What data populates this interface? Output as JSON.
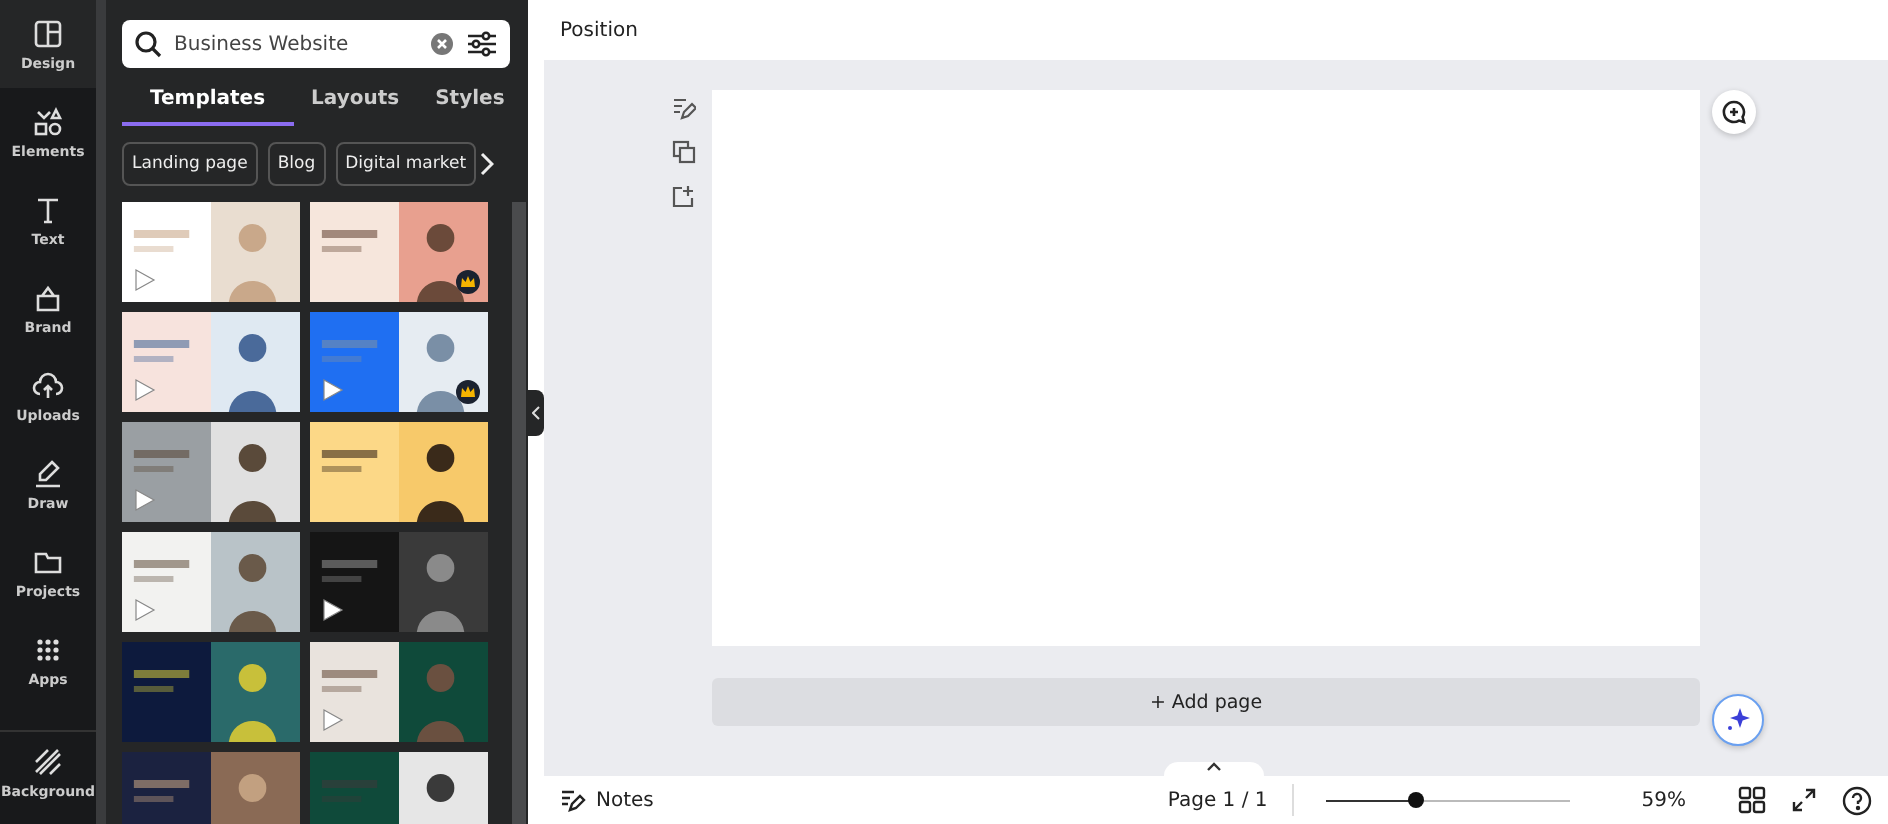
{
  "rail": [
    {
      "label": "Design",
      "selected": true
    },
    {
      "label": "Elements",
      "selected": false
    },
    {
      "label": "Text",
      "selected": false
    },
    {
      "label": "Brand",
      "selected": false
    },
    {
      "label": "Uploads",
      "selected": false
    },
    {
      "label": "Draw",
      "selected": false
    },
    {
      "label": "Projects",
      "selected": false
    },
    {
      "label": "Apps",
      "selected": false
    },
    {
      "label": "Background",
      "selected": false
    }
  ],
  "search": {
    "value": "Business Website"
  },
  "tabs": [
    {
      "label": "Templates",
      "selected": true
    },
    {
      "label": "Layouts",
      "selected": false
    },
    {
      "label": "Styles",
      "selected": false
    }
  ],
  "chips": [
    "Landing page",
    "Blog",
    "Digital market"
  ],
  "templates": [
    {
      "kind": "picture",
      "video": true,
      "premium": false
    },
    {
      "kind": "picture",
      "video": false,
      "premium": true
    },
    {
      "kind": "picture",
      "video": true,
      "premium": false
    },
    {
      "kind": "picture",
      "video": true,
      "premium": true
    },
    {
      "kind": "picture",
      "video": true,
      "premium": false
    },
    {
      "kind": "picture",
      "video": false,
      "premium": false
    },
    {
      "kind": "picture",
      "video": true,
      "premium": false
    },
    {
      "kind": "picture",
      "video": true,
      "premium": false
    },
    {
      "kind": "picture",
      "video": false,
      "premium": false
    },
    {
      "kind": "picture",
      "video": true,
      "premium": false
    },
    {
      "kind": "picture",
      "video": false,
      "premium": false
    },
    {
      "kind": "picture",
      "video": false,
      "premium": false
    }
  ],
  "topbar": {
    "title": "Position"
  },
  "add_page": "+ Add page",
  "footer": {
    "notes": "Notes",
    "page": "Page 1 / 1",
    "zoom_slider": {
      "level": 0.37
    },
    "zoom": "59%"
  }
}
